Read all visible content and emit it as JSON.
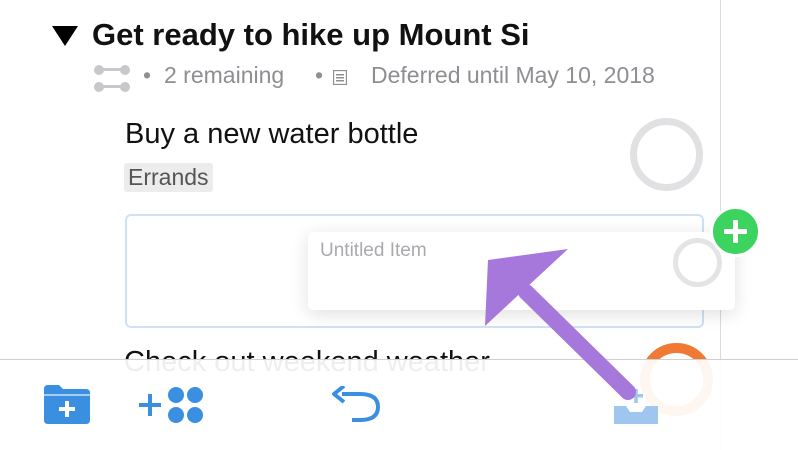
{
  "colors": {
    "accent_blue": "#3b8fe0",
    "light_blue": "#9ec6ef",
    "green_add": "#3dd35f",
    "orange": "#f07a34",
    "annotation_arrow": "#a678db"
  },
  "project": {
    "title": "Get ready to hike up Mount Si",
    "remaining": "2 remaining",
    "deferred": "Deferred until May 10, 2018"
  },
  "tasks": [
    {
      "title": "Buy a new water bottle",
      "tag": "Errands"
    }
  ],
  "drag_item": {
    "placeholder": "Untitled Item"
  },
  "next_task_partial": {
    "title": "Check out weekend weather"
  },
  "toolbar": {
    "icons": [
      "new-folder-icon",
      "add-tags-icon",
      "undo-icon",
      "add-to-inbox-icon"
    ]
  }
}
